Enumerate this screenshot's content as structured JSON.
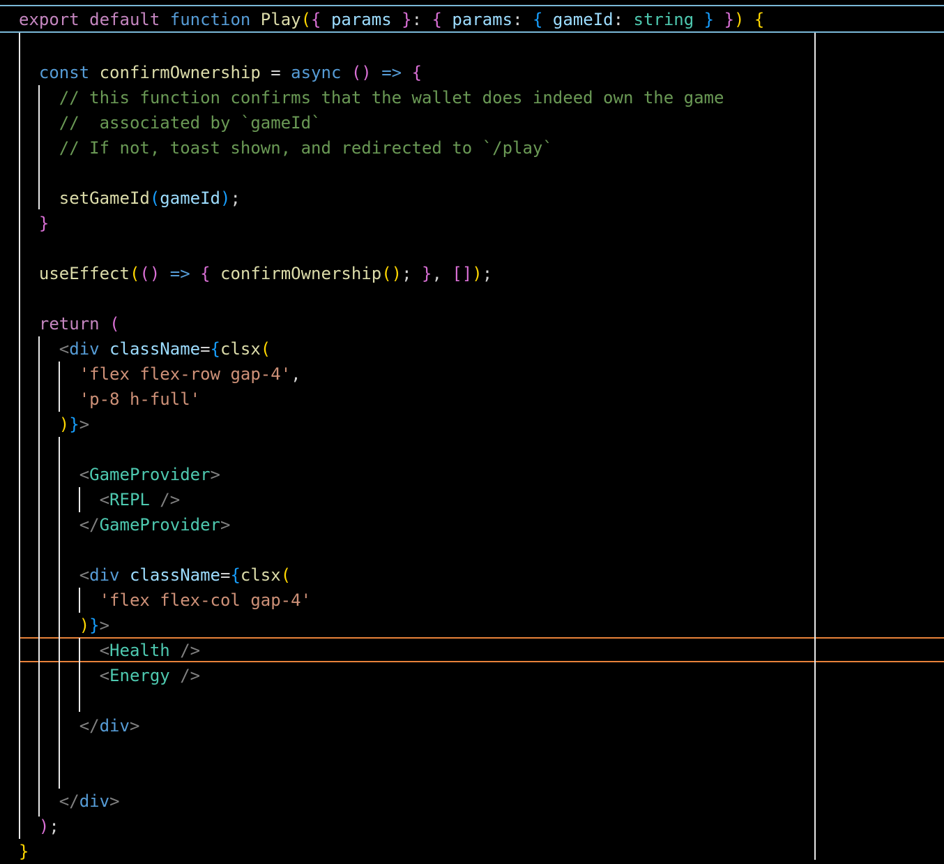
{
  "editor": {
    "colors": {
      "sticky_border": "#7ab8d8",
      "cursor_line_border": "#e8823a",
      "ruler": "#e8e8e8"
    },
    "sticky_line": [
      [
        "export ",
        "kw"
      ],
      [
        "default ",
        "kw"
      ],
      [
        "function ",
        "st"
      ],
      [
        "Play",
        "fn"
      ],
      [
        "(",
        "b1"
      ],
      [
        "{ ",
        "b2"
      ],
      [
        "params ",
        "pa"
      ],
      [
        "}",
        "b2"
      ],
      [
        ": ",
        "pl"
      ],
      [
        "{ ",
        "b2"
      ],
      [
        "params",
        "pa"
      ],
      [
        ": ",
        "pl"
      ],
      [
        "{ ",
        "b3"
      ],
      [
        "gameId",
        "pa"
      ],
      [
        ": ",
        "pl"
      ],
      [
        "string ",
        "ty"
      ],
      [
        "} ",
        "b3"
      ],
      [
        "}",
        "b2"
      ],
      [
        ")",
        "b1"
      ],
      [
        " {",
        "b1"
      ]
    ],
    "lines": [
      [
        [
          "  "
        ],
        [
          "const ",
          "st"
        ],
        [
          "confirmOwnership",
          "fn"
        ],
        [
          " = ",
          "pl"
        ],
        [
          "async ",
          "st"
        ],
        [
          "()",
          "b2"
        ],
        [
          " => ",
          "st"
        ],
        [
          "{",
          "b2"
        ]
      ],
      [
        [
          "    "
        ],
        [
          "// this function confirms that the wallet does indeed own the game",
          "cm"
        ]
      ],
      [
        [
          "    "
        ],
        [
          "//  associated by `gameId`",
          "cm"
        ]
      ],
      [
        [
          "    "
        ],
        [
          "// If not, toast shown, and redirected to `/play`",
          "cm"
        ]
      ],
      [],
      [
        [
          "    "
        ],
        [
          "setGameId",
          "fn"
        ],
        [
          "(",
          "b3"
        ],
        [
          "gameId",
          "pa"
        ],
        [
          ")",
          "b3"
        ],
        [
          ";",
          "pl"
        ]
      ],
      [
        [
          "  "
        ],
        [
          "}",
          "b2"
        ]
      ],
      [],
      [
        [
          "  "
        ],
        [
          "useEffect",
          "fn"
        ],
        [
          "(",
          "b1"
        ],
        [
          "()",
          "b2"
        ],
        [
          " => ",
          "st"
        ],
        [
          "{ ",
          "b2"
        ],
        [
          "confirmOwnership",
          "fn"
        ],
        [
          "()",
          "b1"
        ],
        [
          "; ",
          "pl"
        ],
        [
          "}",
          "b2"
        ],
        [
          ", ",
          "pl"
        ],
        [
          "[]",
          "b2"
        ],
        [
          ")",
          "b1"
        ],
        [
          ";",
          "pl"
        ]
      ],
      [],
      [
        [
          "  "
        ],
        [
          "return ",
          "kw"
        ],
        [
          "(",
          "b2"
        ]
      ],
      [
        [
          "    "
        ],
        [
          "<",
          "ang"
        ],
        [
          "div ",
          "html"
        ],
        [
          "className",
          "pa"
        ],
        [
          "=",
          "pl"
        ],
        [
          "{",
          "b3"
        ],
        [
          "clsx",
          "fn"
        ],
        [
          "(",
          "b1"
        ]
      ],
      [
        [
          "      "
        ],
        [
          "'flex flex-row gap-4'",
          "str"
        ],
        [
          ",",
          "pl"
        ]
      ],
      [
        [
          "      "
        ],
        [
          "'p-8 h-full'",
          "str"
        ]
      ],
      [
        [
          "    "
        ],
        [
          ")",
          "b1"
        ],
        [
          "}",
          "b3"
        ],
        [
          ">",
          "ang"
        ]
      ],
      [],
      [
        [
          "      "
        ],
        [
          "<",
          "ang"
        ],
        [
          "GameProvider",
          "tag"
        ],
        [
          ">",
          "ang"
        ]
      ],
      [
        [
          "        "
        ],
        [
          "<",
          "ang"
        ],
        [
          "REPL ",
          "tag"
        ],
        [
          "/>",
          "ang"
        ]
      ],
      [
        [
          "      "
        ],
        [
          "</",
          "ang"
        ],
        [
          "GameProvider",
          "tag"
        ],
        [
          ">",
          "ang"
        ]
      ],
      [],
      [
        [
          "      "
        ],
        [
          "<",
          "ang"
        ],
        [
          "div ",
          "html"
        ],
        [
          "className",
          "pa"
        ],
        [
          "=",
          "pl"
        ],
        [
          "{",
          "b3"
        ],
        [
          "clsx",
          "fn"
        ],
        [
          "(",
          "b1"
        ]
      ],
      [
        [
          "        "
        ],
        [
          "'flex flex-col gap-4'",
          "str"
        ]
      ],
      [
        [
          "      "
        ],
        [
          ")",
          "b1"
        ],
        [
          "}",
          "b3"
        ],
        [
          ">",
          "ang"
        ]
      ],
      [
        [
          "        "
        ],
        [
          "<",
          "ang"
        ],
        [
          "Health ",
          "tag"
        ],
        [
          "/>",
          "ang"
        ]
      ],
      [
        [
          "        "
        ],
        [
          "<",
          "ang"
        ],
        [
          "Energy ",
          "tag"
        ],
        [
          "/>",
          "ang"
        ]
      ],
      [],
      [
        [
          "      "
        ],
        [
          "</",
          "ang"
        ],
        [
          "div",
          "html"
        ],
        [
          ">",
          "ang"
        ]
      ],
      [],
      [],
      [
        [
          "    "
        ],
        [
          "</",
          "ang"
        ],
        [
          "div",
          "html"
        ],
        [
          ">",
          "ang"
        ]
      ],
      [
        [
          "  "
        ],
        [
          ")",
          "b2"
        ],
        [
          ";",
          "pl"
        ]
      ],
      [
        [
          "}",
          "b1"
        ]
      ]
    ]
  }
}
